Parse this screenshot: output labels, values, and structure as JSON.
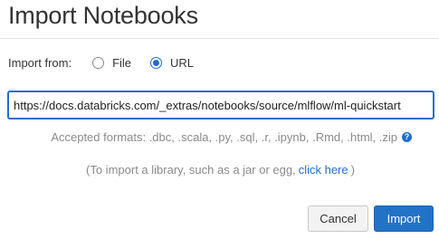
{
  "dialog": {
    "title": "Import Notebooks"
  },
  "import_from": {
    "label": "Import from:",
    "options": [
      {
        "label": "File",
        "selected": false
      },
      {
        "label": "URL",
        "selected": true
      }
    ]
  },
  "url_input": {
    "value": "https://docs.databricks.com/_extras/notebooks/source/mlflow/ml-quickstart"
  },
  "formats": {
    "text": "Accepted formats: .dbc, .scala, .py, .sql, .r, .ipynb, .Rmd, .html, .zip",
    "help_icon": "question-circle-icon"
  },
  "library": {
    "prefix": "(To import a library, such as a jar or egg,",
    "link": "click here",
    "suffix": ")"
  },
  "buttons": {
    "cancel": "Cancel",
    "import": "Import"
  },
  "colors": {
    "accent": "#1f6dd1",
    "primary_button": "#2272c8",
    "muted_text": "#8a8a8a"
  }
}
